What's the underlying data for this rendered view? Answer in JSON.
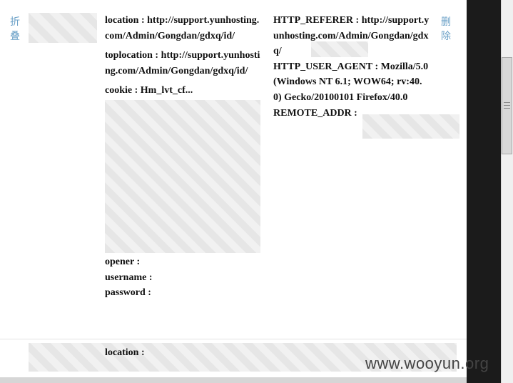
{
  "record": {
    "fold_label": "折叠",
    "delete_label": "删除",
    "left_fields": [
      {
        "label": "location",
        "value": "http://support.yunhosting.com/Admin/Gongdan/gdxq/id/"
      },
      {
        "label": "toplocation",
        "value": "http://support.yunhosting.com/Admin/Gongdan/gdxq/id/"
      },
      {
        "label": "cookie",
        "value": "Hm_lvt_cf..."
      },
      {
        "label": "opener",
        "value": ""
      },
      {
        "label": "username",
        "value": ""
      },
      {
        "label": "password",
        "value": ""
      }
    ],
    "right_fields": [
      {
        "label": "HTTP_REFERER",
        "value": "http://support.yunhosting.com/Admin/Gongdan/gdxq/"
      },
      {
        "label": "HTTP_USER_AGENT",
        "value": "Mozilla/5.0 (Windows NT 6.1; WOW64; rv:40.0) Gecko/20100101 Firefox/40.0"
      },
      {
        "label": "REMOTE_ADDR",
        "value": ""
      }
    ]
  },
  "next_record": {
    "label": "location :"
  },
  "watermark": "www.wooyun.org"
}
